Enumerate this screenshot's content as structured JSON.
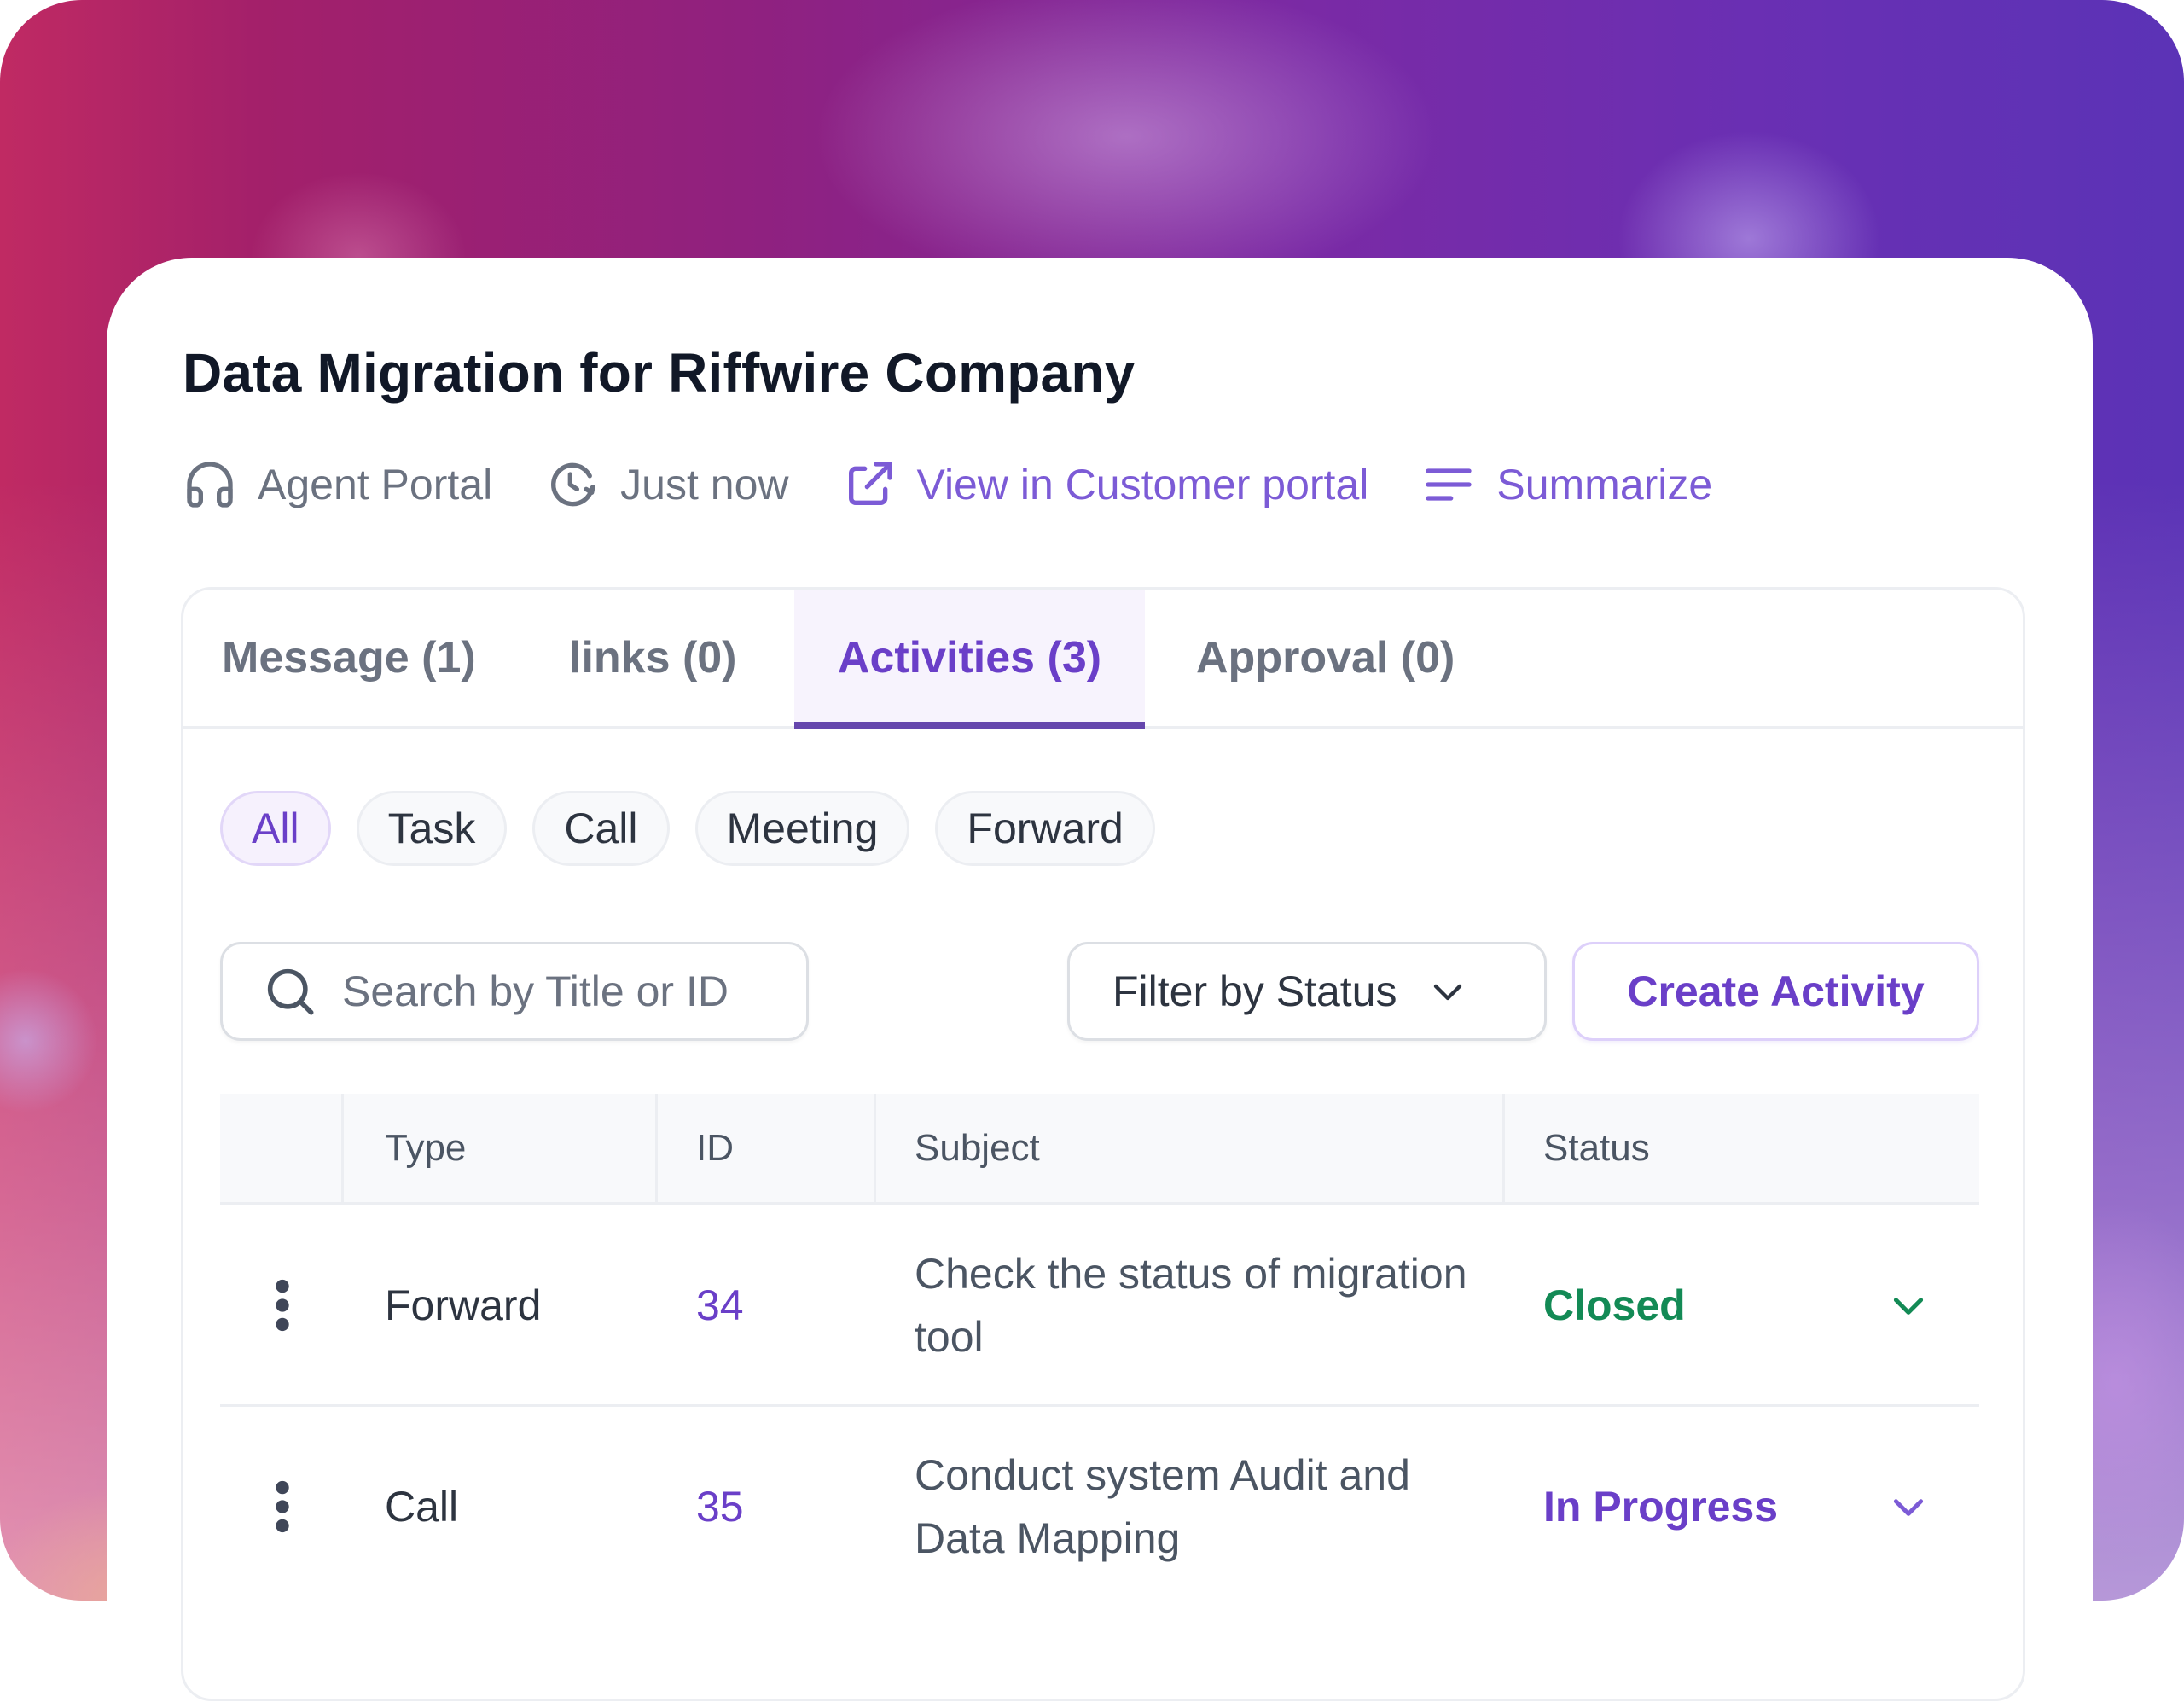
{
  "header": {
    "title": "Data Migration for Riffwire Company",
    "meta": [
      {
        "icon": "headphones-icon",
        "label": "Agent Portal"
      },
      {
        "icon": "clock-history-icon",
        "label": "Just now"
      },
      {
        "icon": "external-link-icon",
        "label": "View in Customer portal"
      },
      {
        "icon": "summarize-lines-icon",
        "label": "Summarize"
      }
    ]
  },
  "tabs": [
    {
      "label": "Message (1)",
      "active": false
    },
    {
      "label": "links (0)",
      "active": false
    },
    {
      "label": "Activities (3)",
      "active": true
    },
    {
      "label": "Approval (0)",
      "active": false
    }
  ],
  "filters": {
    "chips": [
      {
        "label": "All",
        "active": true
      },
      {
        "label": "Task",
        "active": false
      },
      {
        "label": "Call",
        "active": false
      },
      {
        "label": "Meeting",
        "active": false
      },
      {
        "label": "Forward",
        "active": false
      }
    ],
    "search_placeholder": "Search by Title or ID",
    "search_value": "",
    "status_filter_label": "Filter by Status",
    "create_button_label": "Create Activity"
  },
  "table": {
    "columns": [
      "",
      "Type",
      "ID",
      "Subject",
      "Status"
    ],
    "rows": [
      {
        "type": "Forward",
        "id": "34",
        "subject": "Check the status of migration tool",
        "status": "Closed",
        "status_color": "#138a55"
      },
      {
        "type": "Call",
        "id": "35",
        "subject": "Conduct system Audit and Data Mapping",
        "status": "In Progress",
        "status_color": "#6a3fc8"
      }
    ]
  },
  "colors": {
    "accent": "#6a3fc8",
    "accent_link": "#7c5bd6",
    "text_primary": "#111827",
    "text_muted": "#6b7280",
    "status_closed": "#138a55",
    "status_in_progress": "#6a3fc8"
  }
}
